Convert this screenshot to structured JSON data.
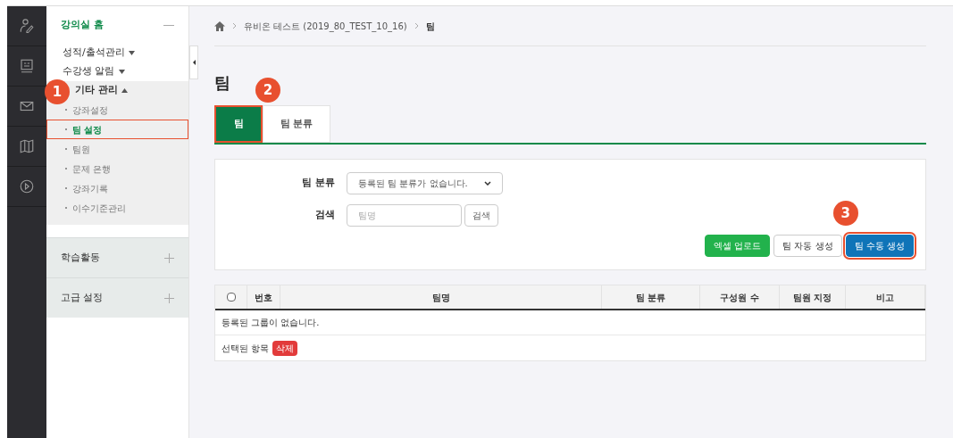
{
  "rail": [
    {
      "kind": "person"
    },
    {
      "kind": "board"
    },
    {
      "kind": "mail"
    },
    {
      "kind": "map"
    },
    {
      "kind": "play"
    }
  ],
  "sidebar": {
    "home": {
      "label": "강의실 홈",
      "expanded": true
    },
    "menus": [
      {
        "label": "성적/출석관리",
        "expanded": false
      },
      {
        "label": "수강생 알림",
        "expanded": false
      },
      {
        "label": "기타 관리",
        "expanded": true,
        "callout": "1",
        "children": [
          {
            "label": "강좌설정",
            "selected": false,
            "highlighted": false
          },
          {
            "label": "팀 설정",
            "selected": true,
            "highlighted": true
          },
          {
            "label": "팀원",
            "selected": false,
            "highlighted": false
          },
          {
            "label": "문제 은행",
            "selected": false,
            "highlighted": false
          },
          {
            "label": "강좌기록",
            "selected": false,
            "highlighted": false
          },
          {
            "label": "이수기준관리",
            "selected": false,
            "highlighted": false
          }
        ]
      }
    ],
    "sections": [
      {
        "label": "학습활동",
        "expanded": false
      },
      {
        "label": "고급 설정",
        "expanded": false
      }
    ]
  },
  "breadcrumb": [
    "유비온 테스트 (2019_80_TEST_10_16)",
    "팀"
  ],
  "title": "팀",
  "tabs": [
    {
      "label": "팀",
      "selected": true,
      "highlighted": true,
      "callout": "2"
    },
    {
      "label": "팀 분류",
      "selected": false,
      "highlighted": false
    }
  ],
  "filter": {
    "category_label": "팀 분류",
    "category_value": "등록된 팀 분류가 없습니다.",
    "search_label": "검색",
    "search_placeholder": "팀명",
    "search_button": "검색"
  },
  "actions": [
    {
      "label": "엑셀 업로드",
      "kind": "green",
      "highlighted": false
    },
    {
      "label": "팀 자동 생성",
      "kind": "plain",
      "highlighted": false
    },
    {
      "label": "팀 수동 생성",
      "kind": "blue",
      "highlighted": true,
      "callout": "3"
    }
  ],
  "table": {
    "select_all": {
      "checked": false
    },
    "columns": [
      "번호",
      "팀명",
      "팀 분류",
      "구성원 수",
      "팀원 지정",
      "비고"
    ],
    "empty": "등록된 그룹이 없습니다.",
    "selected_label": "선택된 항목",
    "delete": "삭제"
  }
}
